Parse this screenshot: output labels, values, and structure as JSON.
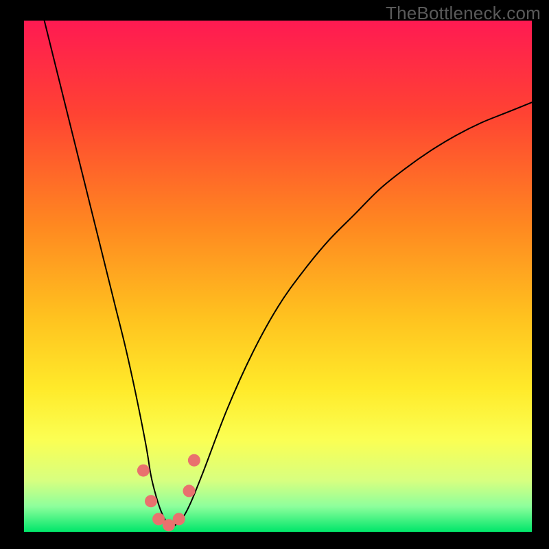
{
  "watermark": "TheBottleneck.com",
  "chart_data": {
    "type": "line",
    "title": "",
    "xlabel": "",
    "ylabel": "",
    "xlim": [
      0,
      100
    ],
    "ylim": [
      0,
      100
    ],
    "grid": false,
    "legend": false,
    "background_gradient": {
      "stops": [
        {
          "offset": 0.0,
          "color": "#ff1a52"
        },
        {
          "offset": 0.18,
          "color": "#ff4233"
        },
        {
          "offset": 0.4,
          "color": "#ff8820"
        },
        {
          "offset": 0.58,
          "color": "#ffc21f"
        },
        {
          "offset": 0.72,
          "color": "#ffea2a"
        },
        {
          "offset": 0.82,
          "color": "#fbff53"
        },
        {
          "offset": 0.9,
          "color": "#d7ff80"
        },
        {
          "offset": 0.95,
          "color": "#8eff9c"
        },
        {
          "offset": 1.0,
          "color": "#00e66a"
        }
      ]
    },
    "series": [
      {
        "name": "bottleneck-curve",
        "stroke": "#000000",
        "stroke_width": 2,
        "x": [
          4,
          6,
          8,
          10,
          12,
          14,
          16,
          18,
          20,
          22,
          24,
          25,
          26,
          27,
          28,
          29,
          30,
          32,
          35,
          40,
          45,
          50,
          55,
          60,
          65,
          70,
          75,
          80,
          85,
          90,
          95,
          100
        ],
        "y": [
          100,
          92,
          84,
          76,
          68,
          60,
          52,
          44,
          36,
          27,
          17,
          11,
          7,
          4,
          2,
          1.2,
          1.5,
          4,
          11,
          24,
          35,
          44,
          51,
          57,
          62,
          67,
          71,
          74.5,
          77.5,
          80,
          82,
          84
        ]
      }
    ],
    "markers": {
      "name": "highlight-dots",
      "color": "#e9716e",
      "radius_px": 9,
      "points": [
        {
          "x": 23.5,
          "y": 12
        },
        {
          "x": 25.0,
          "y": 6
        },
        {
          "x": 26.5,
          "y": 2.5
        },
        {
          "x": 28.5,
          "y": 1.3
        },
        {
          "x": 30.5,
          "y": 2.5
        },
        {
          "x": 32.5,
          "y": 8
        },
        {
          "x": 33.5,
          "y": 14
        }
      ]
    }
  }
}
